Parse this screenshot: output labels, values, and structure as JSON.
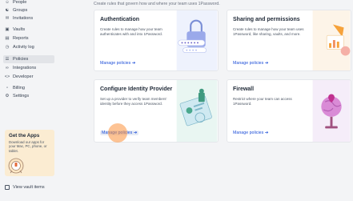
{
  "sidebar": {
    "items": [
      {
        "label": "People",
        "icon": "person-icon"
      },
      {
        "label": "Groups",
        "icon": "groups-icon"
      },
      {
        "label": "Invitations",
        "icon": "mail-icon"
      },
      {
        "label": "Vaults",
        "icon": "vault-icon"
      },
      {
        "label": "Reports",
        "icon": "reports-icon"
      },
      {
        "label": "Activity log",
        "icon": "activity-icon"
      },
      {
        "label": "Policies",
        "icon": "policies-icon",
        "active": true
      },
      {
        "label": "Integrations",
        "icon": "integrations-icon"
      },
      {
        "label": "Developer",
        "icon": "developer-icon"
      },
      {
        "label": "Billing",
        "icon": "billing-icon"
      },
      {
        "label": "Settings",
        "icon": "settings-icon"
      }
    ],
    "promo": {
      "title": "Get the Apps",
      "text": "Download our apps for your Mac, PC, phone, or tablet."
    },
    "view_vault_items": "View vault items"
  },
  "main": {
    "subtitle": "Create rules that govern how and where your team uses 1Password.",
    "cards": [
      {
        "title": "Authentication",
        "description": "Create rules to manage how your team authenticates with and into 1Password.",
        "link": "Manage policies",
        "accent": "#e8eefc"
      },
      {
        "title": "Sharing and permissions",
        "description": "Create rules to manage how your team uses 1Password, like sharing, vaults, and more.",
        "link": "Manage policies",
        "accent": "#fdf3e6"
      },
      {
        "title": "Configure Identity Provider",
        "description": "Set up a provider to verify team members' identity before they access 1Password.",
        "link": "Manage policies",
        "accent": "#e6f5f1"
      },
      {
        "title": "Firewall",
        "description": "Restrict where your team can access 1Password.",
        "link": "Manage policies",
        "accent": "#f5ecfa"
      }
    ]
  },
  "colors": {
    "link": "#1d4ed8",
    "cursor_highlight": "#fb923c",
    "promo_bg": "#fbecd2"
  }
}
